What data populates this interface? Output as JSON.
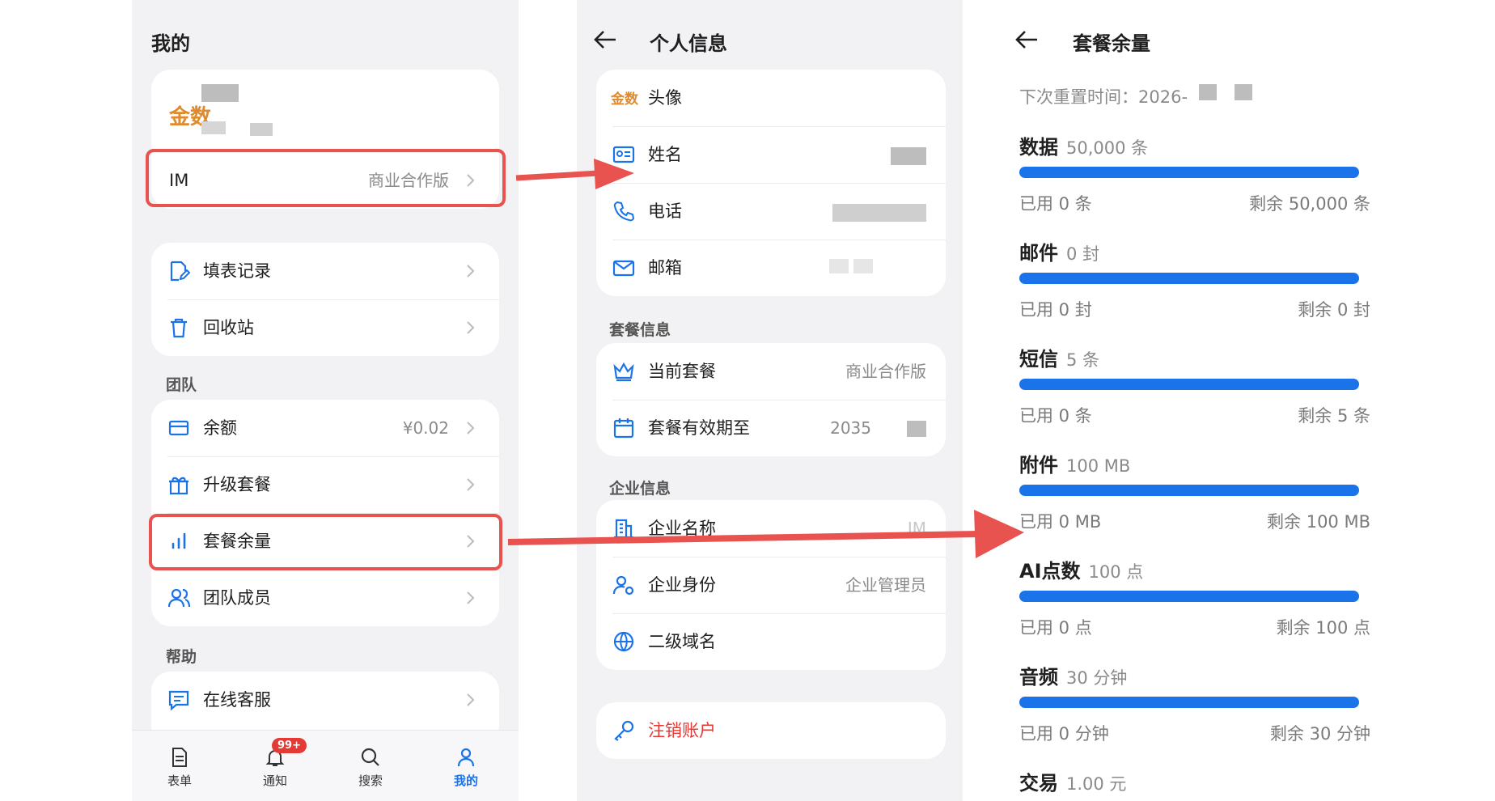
{
  "colors": {
    "accent": "#1a73e8",
    "danger": "#e8524f",
    "annotation": "#e8524f",
    "muted": "#8a8a8a"
  },
  "mine": {
    "title": "我的",
    "account_logo_text": "金数",
    "im_row": {
      "label": "IM",
      "value": "商业合作版"
    },
    "menu": [
      {
        "label": "填表记录",
        "icon": "form-edit-icon"
      },
      {
        "label": "回收站",
        "icon": "trash-icon"
      }
    ],
    "team_section": "团队",
    "team": [
      {
        "label": "余额",
        "value": "¥0.02",
        "icon": "wallet-icon"
      },
      {
        "label": "升级套餐",
        "value": "",
        "icon": "gift-icon"
      },
      {
        "label": "套餐余量",
        "value": "",
        "icon": "bar-chart-icon"
      },
      {
        "label": "团队成员",
        "value": "",
        "icon": "members-icon"
      }
    ],
    "help_section": "帮助",
    "help": [
      {
        "label": "在线客服",
        "icon": "chat-icon"
      }
    ],
    "tabbar": [
      {
        "label": "表单",
        "icon": "form-icon",
        "active": false
      },
      {
        "label": "通知",
        "icon": "bell-icon",
        "active": false,
        "badge": "99+"
      },
      {
        "label": "搜索",
        "icon": "search-icon",
        "active": false
      },
      {
        "label": "我的",
        "icon": "user-icon",
        "active": true
      }
    ]
  },
  "profile": {
    "title": "个人信息",
    "avatar_logo_text": "金数",
    "personal": [
      {
        "label": "头像",
        "icon": "avatar-icon"
      },
      {
        "label": "姓名",
        "icon": "id-card-icon"
      },
      {
        "label": "电话",
        "icon": "phone-icon"
      },
      {
        "label": "邮箱",
        "icon": "mail-icon"
      }
    ],
    "plan_section": "套餐信息",
    "plan": [
      {
        "label": "当前套餐",
        "value": "商业合作版",
        "icon": "crown-icon"
      },
      {
        "label": "套餐有效期至",
        "value": "2035",
        "icon": "calendar-icon"
      }
    ],
    "company_section": "企业信息",
    "company": [
      {
        "label": "企业名称",
        "value": "IM",
        "icon": "building-icon"
      },
      {
        "label": "企业身份",
        "value": "企业管理员",
        "icon": "user-gear-icon"
      },
      {
        "label": "二级域名",
        "value": "",
        "icon": "globe-icon"
      }
    ],
    "logout": {
      "label": "注销账户",
      "icon": "key-icon"
    }
  },
  "quota": {
    "title": "套餐余量",
    "reset_text": "下次重置时间：2026-",
    "items": [
      {
        "name": "数据",
        "total": "50,000 条",
        "used": "已用 0 条",
        "left": "剩余 50,000 条",
        "used_fraction": 0
      },
      {
        "name": "邮件",
        "total": "0 封",
        "used": "已用 0 封",
        "left": "剩余 0 封",
        "used_fraction": 0
      },
      {
        "name": "短信",
        "total": "5 条",
        "used": "已用 0 条",
        "left": "剩余 5 条",
        "used_fraction": 0
      },
      {
        "name": "附件",
        "total": "100 MB",
        "used": "已用 0 MB",
        "left": "剩余 100 MB",
        "used_fraction": 0
      },
      {
        "name": "AI点数",
        "total": "100 点",
        "used": "已用 0 点",
        "left": "剩余 100 点",
        "used_fraction": 0
      },
      {
        "name": "音频",
        "total": "30 分钟",
        "used": "已用 0 分钟",
        "left": "剩余 30 分钟",
        "used_fraction": 0
      },
      {
        "name": "交易",
        "total": "1.00 元"
      }
    ]
  }
}
